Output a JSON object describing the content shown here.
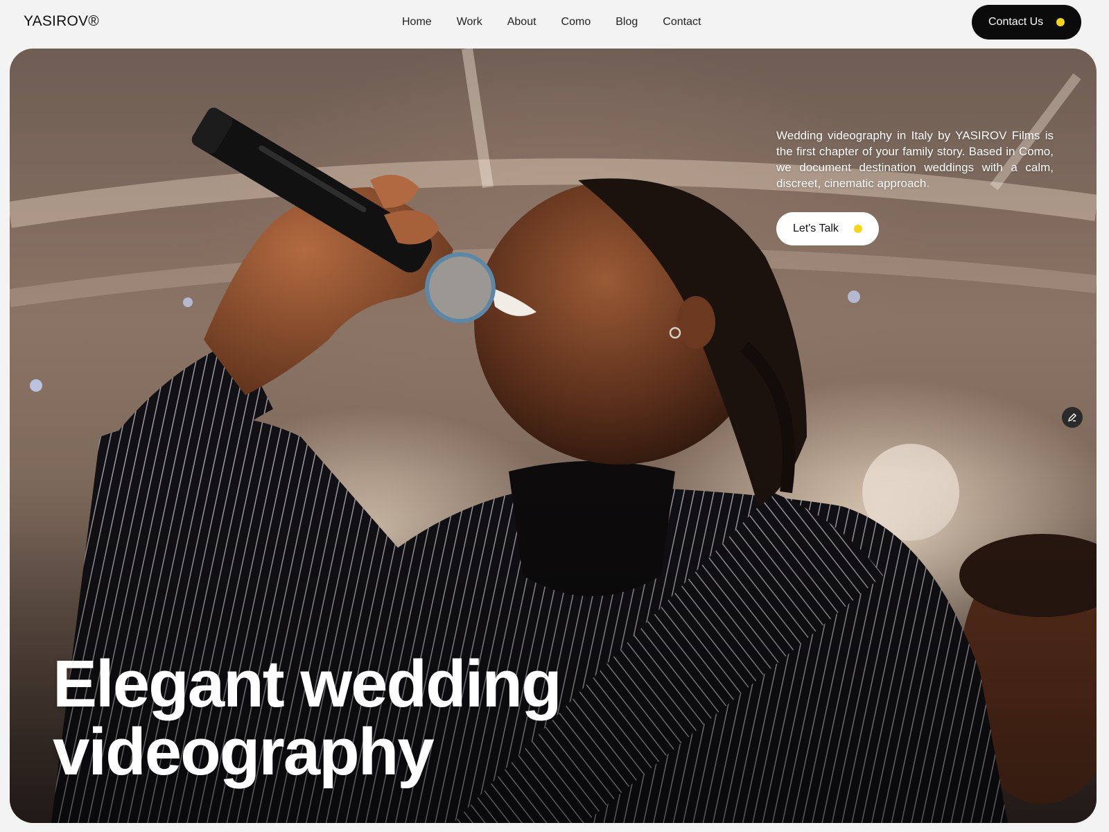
{
  "header": {
    "logo": "YASIROV®",
    "nav": [
      "Home",
      "Work",
      "About",
      "Como",
      "Blog",
      "Contact"
    ],
    "cta_label": "Contact Us"
  },
  "hero": {
    "description": "Wedding videography in Italy by YASIROV Films is the first chapter of your family story. Based in Como, we document destination weddings with a calm, discreet, cinematic approach.",
    "cta_label": "Let's Talk",
    "headline_line1": "Elegant wedding",
    "headline_line2": "videography"
  },
  "colors": {
    "accent_dot": "#f7d518",
    "dark": "#0b0b0b",
    "page_bg": "#f3f3f3"
  },
  "icons": {
    "edit": "pencil-icon",
    "cta_dot": "yellow-dot-icon"
  }
}
